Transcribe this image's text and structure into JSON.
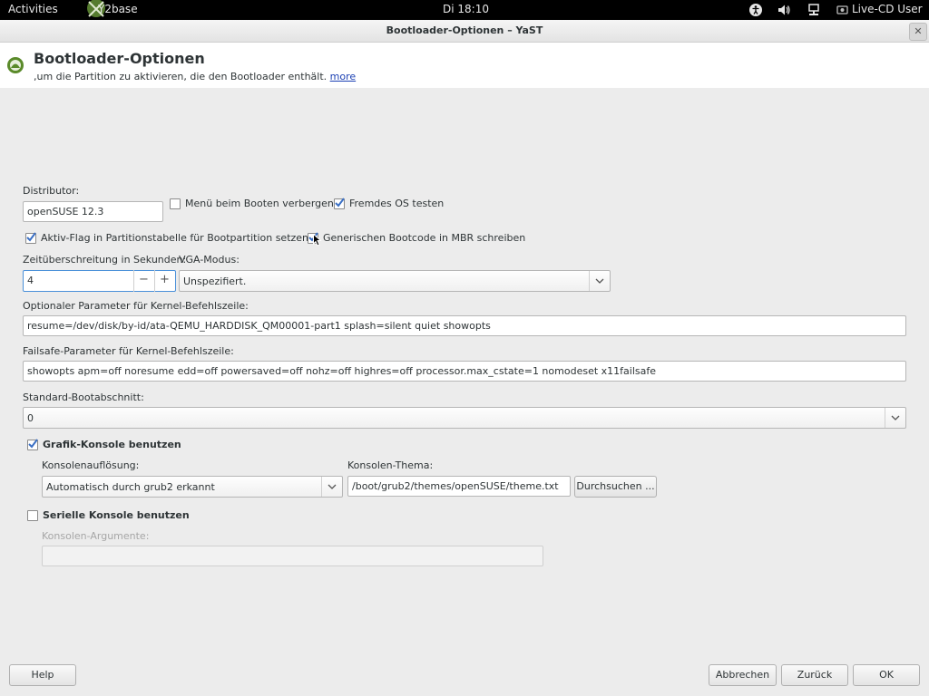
{
  "topbar": {
    "activities": "Activities",
    "app_name": "Y2base",
    "clock": "Di 18:10",
    "user": "Live-CD User",
    "icons": [
      "accessibility-icon",
      "volume-icon",
      "network-icon",
      "user-icon"
    ]
  },
  "window": {
    "title": "Bootloader-Optionen – YaST",
    "close_glyph": "✕"
  },
  "header": {
    "title": "Bootloader-Optionen",
    "subtitle": ",um die Partition zu aktivieren, die den Bootloader enthält. ",
    "more_link": "more"
  },
  "form": {
    "distributor_label": "Distributor:",
    "distributor_value": "openSUSE 12.3",
    "hide_menu_label": "Menü beim Booten verbergen",
    "hide_menu_checked": false,
    "foreign_os_label": "Fremdes OS testen",
    "foreign_os_checked": true,
    "active_flag_label": "Aktiv-Flag in Partitionstabelle für Bootpartition setzen",
    "active_flag_checked": true,
    "generic_boot_label": "Generischen Bootcode in MBR schreiben",
    "generic_boot_checked": true,
    "timeout_label": "Zeitüberschreitung in Sekunden:",
    "timeout_value": "4",
    "spin_minus": "−",
    "spin_plus": "+",
    "vga_label": "VGA-Modus:",
    "vga_value": "Unspezifiert.",
    "kernel_param_label": "Optionaler Parameter für Kernel-Befehlszeile:",
    "kernel_param_value": "resume=/dev/disk/by-id/ata-QEMU_HARDDISK_QM00001-part1 splash=silent quiet showopts",
    "failsafe_label": "Failsafe-Parameter für Kernel-Befehlszeile:",
    "failsafe_value": "showopts apm=off noresume edd=off powersaved=off nohz=off highres=off processor.max_cstate=1 nomodeset x11failsafe",
    "default_section_label": "Standard-Bootabschnitt:",
    "default_section_value": "0",
    "graphic_console_label": "Grafik-Konsole benutzen",
    "graphic_console_checked": true,
    "console_resolution_label": "Konsolenauflösung:",
    "console_resolution_value": "Automatisch durch grub2 erkannt",
    "console_theme_label": "Konsolen-Thema:",
    "console_theme_value": "/boot/grub2/themes/openSUSE/theme.txt",
    "browse_button": "Durchsuchen ...",
    "serial_console_label": "Serielle Konsole benutzen",
    "serial_console_checked": false,
    "console_args_label": "Konsolen-Argumente:",
    "console_args_value": ""
  },
  "footer": {
    "help": "Help",
    "cancel": "Abbrechen",
    "back": "Zurück",
    "ok": "OK"
  },
  "colors": {
    "accent_check": "#3a6fc4",
    "link": "#1a3fb3",
    "topbar": "#000000"
  }
}
